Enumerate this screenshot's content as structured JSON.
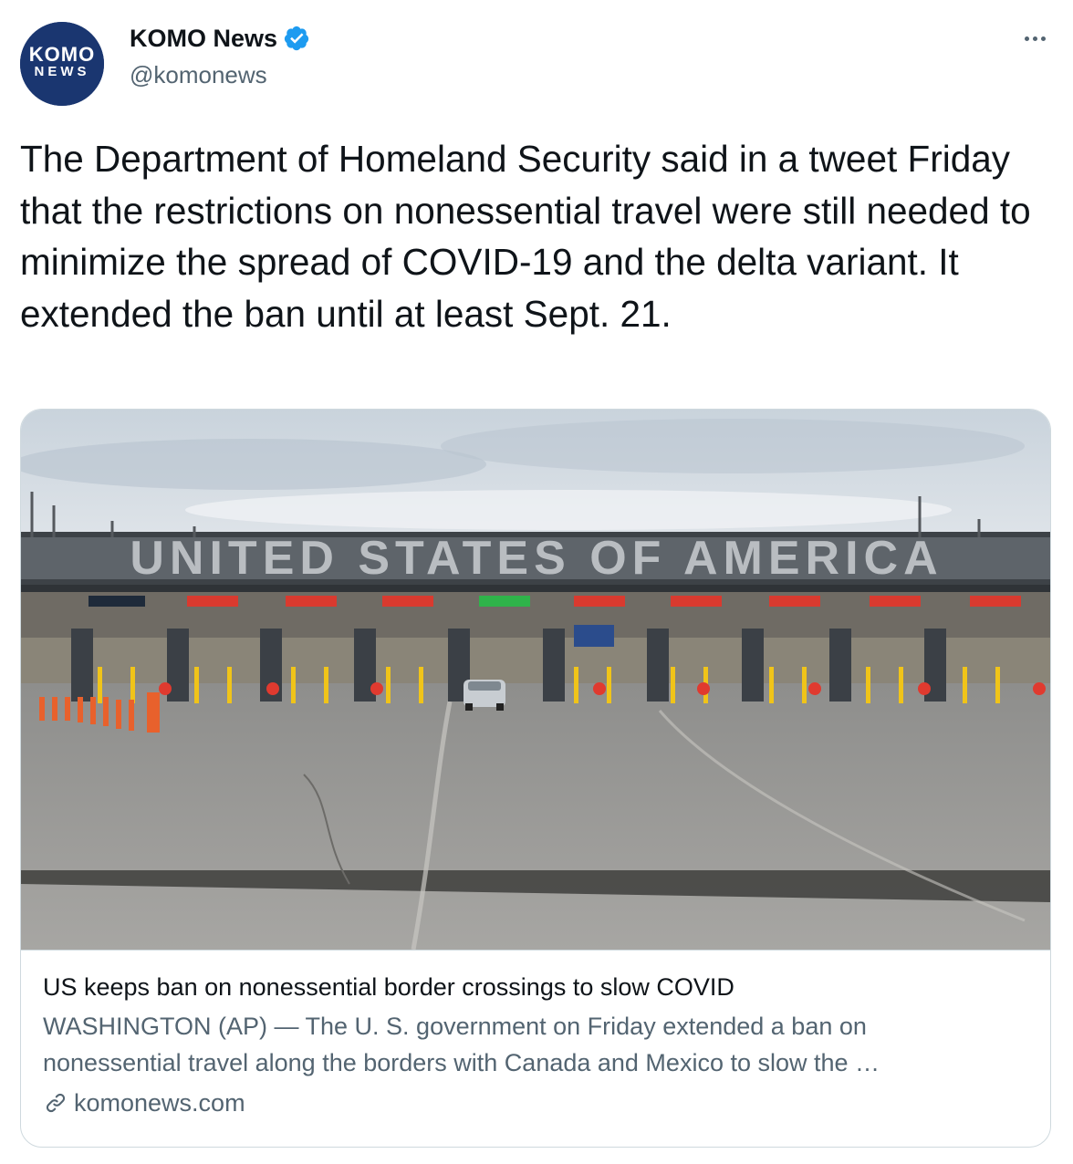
{
  "author": {
    "display_name": "KOMO News",
    "handle": "@komonews",
    "avatar_text_top": "KOMO",
    "avatar_text_bottom": "NEWS",
    "avatar_color": "#1a3670",
    "verified_color": "#1d9bf0"
  },
  "tweet": {
    "text": "The Department of Homeland Security said in a tweet Friday that the restrictions on nonessential travel were still needed to minimize the spread of COVID-19 and the delta variant. It extended the ban until at least Sept. 21."
  },
  "card": {
    "image_sign_text": "UNITED STATES OF AMERICA",
    "title": "US keeps ban on nonessential border crossings to slow COVID",
    "description": "WASHINGTON (AP) — The U. S. government on Friday extended a ban on nonessential travel along the borders with Canada and Mexico to slow the …",
    "domain": "komonews.com",
    "domain_icon": "link-icon"
  },
  "icons": {
    "more": "more-options-icon",
    "verified": "verified-badge-icon"
  }
}
